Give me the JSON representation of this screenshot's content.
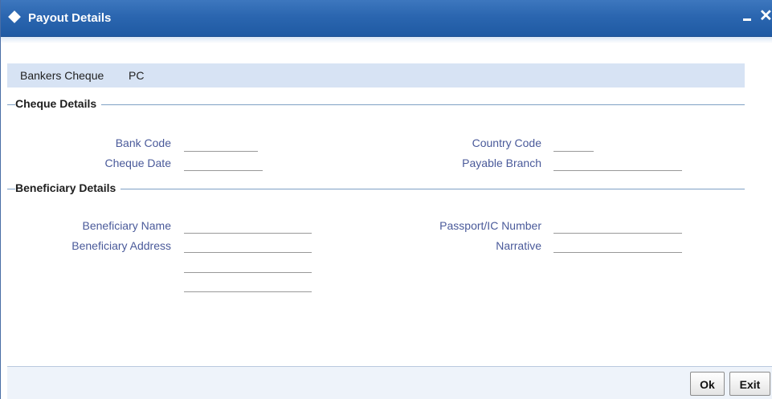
{
  "window": {
    "title": "Payout Details",
    "minimize_label": "_",
    "close_label": "✕"
  },
  "header": {
    "payout_type": "Bankers Cheque",
    "payout_code": "PC"
  },
  "cheque_details": {
    "section_title": "Cheque Details",
    "bank_code_label": "Bank Code",
    "bank_code_value": "",
    "cheque_date_label": "Cheque Date",
    "cheque_date_value": "",
    "country_code_label": "Country Code",
    "country_code_value": "",
    "payable_branch_label": "Payable Branch",
    "payable_branch_value": ""
  },
  "beneficiary_details": {
    "section_title": "Beneficiary Details",
    "name_label": "Beneficiary Name",
    "name_value": "",
    "address_label": "Beneficiary Address",
    "address_lines": [
      "",
      "",
      ""
    ],
    "passport_label": "Passport/IC Number",
    "passport_value": "",
    "narrative_label": "Narrative",
    "narrative_value": ""
  },
  "footer": {
    "ok_label": "Ok",
    "exit_label": "Exit"
  }
}
